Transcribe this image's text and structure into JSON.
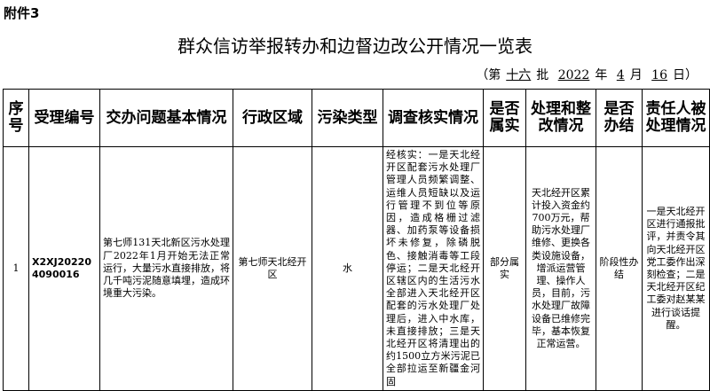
{
  "attachment_label": "附件3",
  "title": "群众信访举报转办和边督边改公开情况一览表",
  "batch": {
    "prefix": "（第",
    "batch_no": "十六",
    "batch_word": "批",
    "year": "2022",
    "year_word": "年",
    "month": "4",
    "month_word": "月",
    "day": "16",
    "day_word": "日）"
  },
  "table": {
    "headers": [
      "序号",
      "受理编号",
      "交办问题基本情况",
      "行政区域",
      "污染类型",
      "调查核实情况",
      "是否属实",
      "处理和整改情况",
      "是否办结",
      "责任人被处理情况"
    ],
    "rows": [
      {
        "seq": "1",
        "receipt_no": "X2XJ202204090016",
        "issue": "第七师131天北新区污水处理厂2022年1月开始无法正常运行，大量污水直接排放，将几千吨污泥随意填埋，造成环境重大污染。",
        "region": "第七师天北经开区",
        "pollution_type": "水",
        "investigation": "经核实：一是天北经开区配套污水处理厂管理人员频繁调整、运维人员短缺以及运行管理不到位等原因，造成格栅过滤器、加药泵等设备损坏未修复，除磷脱色、接触消毒等工段停运；二是天北经开区辖区内的生活污水全部进入天北经开区配套的污水处理厂处理后，进入中水库，未直接排放；三是天北经开区将清理出的约1500立方米污泥已全部拉运至新疆金河固",
        "is_true": "部分属实",
        "handling": "天北经开区累计投入资金约700万元，帮助污水处理厂维修、更换各类设施设备，增派运营管理、操作人员，目前，污水处理厂故障设备已维修完毕，基本恢复正常运营。",
        "concluded": "阶段性办结",
        "accountability": "一是天北经开区进行通报批评，并责令其向天北经开区党工委作出深刻检查；二是天北经开区纪工委对赵某某进行谈话提醒。"
      }
    ]
  }
}
